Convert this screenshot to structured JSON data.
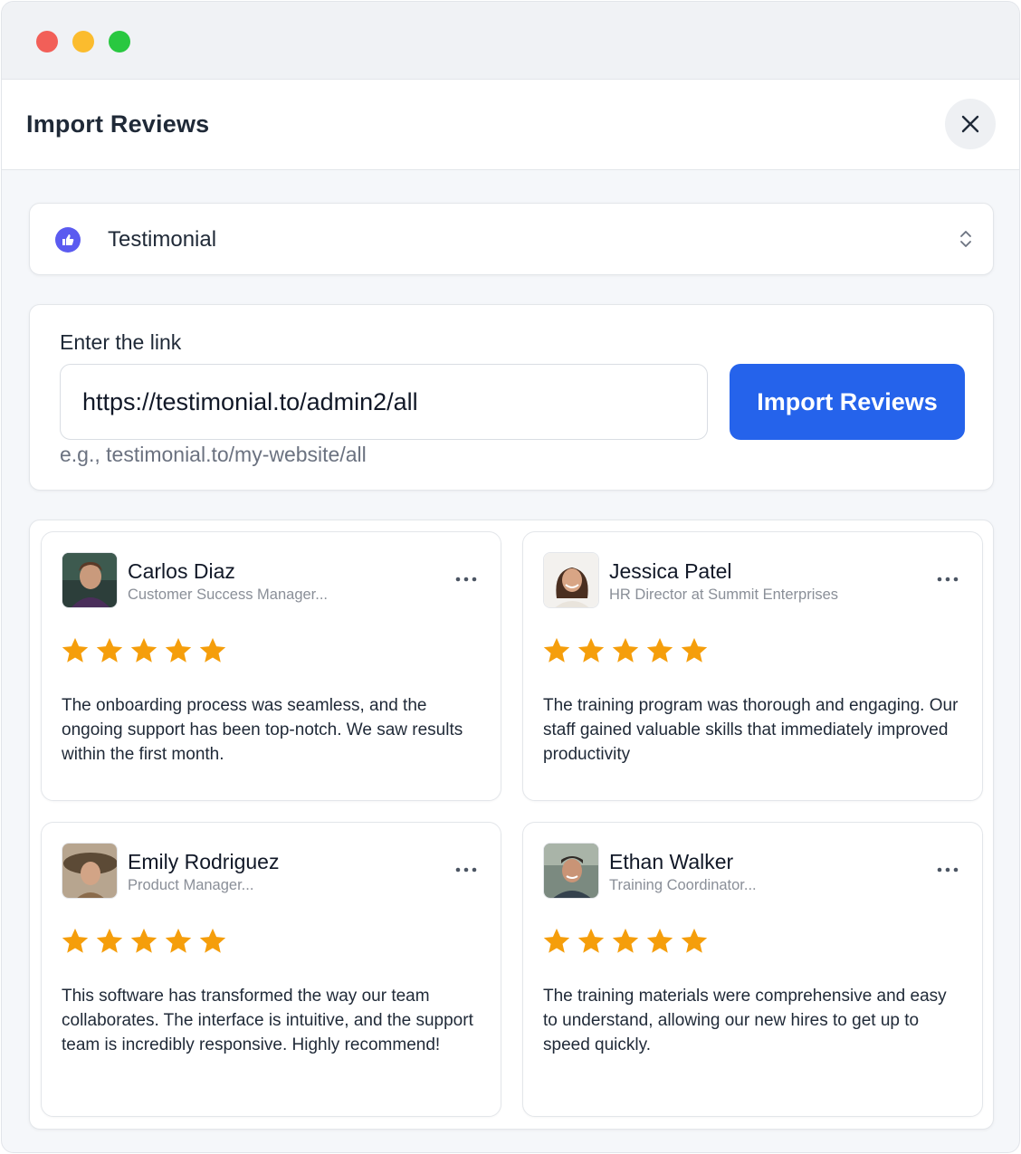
{
  "window": {
    "controls": [
      "close",
      "minimize",
      "maximize"
    ]
  },
  "header": {
    "title": "Import Reviews",
    "close_icon": "close-icon"
  },
  "source_select": {
    "selected": "Testimonial",
    "icon": "thumbs-up-icon",
    "chevron": "chevron-up-down-icon",
    "icon_color": "#5b5bf0"
  },
  "link_form": {
    "label": "Enter the link",
    "value": "https://testimonial.to/admin2/all",
    "hint": "e.g., testimonial.to/my-website/all",
    "button_label": "Import Reviews",
    "button_color": "#2563eb"
  },
  "star_color": "#f59e0b",
  "reviews": [
    {
      "name": "Carlos Diaz",
      "role": "Customer Success Manager...",
      "rating": 5,
      "text": "The onboarding process was seamless, and the ongoing support has been top-notch. We saw results within the first month."
    },
    {
      "name": "Jessica Patel",
      "role": "HR Director at Summit Enterprises",
      "rating": 5,
      "text": "The training program was thorough and engaging. Our staff gained valuable skills that immediately improved productivity"
    },
    {
      "name": "Emily Rodriguez",
      "role": "Product Manager...",
      "rating": 5,
      "text": "This software has transformed the way our team collaborates. The interface is intuitive, and the support team is incredibly responsive. Highly recommend!"
    },
    {
      "name": "Ethan Walker",
      "role": "Training Coordinator...",
      "rating": 5,
      "text": "The training materials were comprehensive and easy to understand, allowing our new hires to get up to speed quickly."
    }
  ]
}
